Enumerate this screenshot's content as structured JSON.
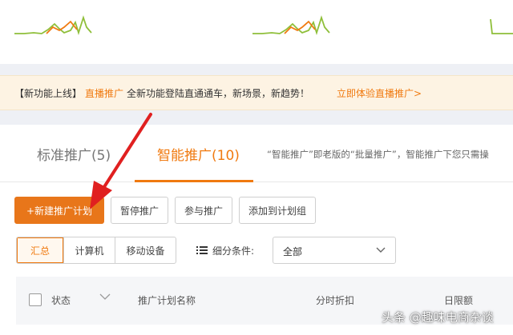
{
  "banner": {
    "tag": "【新功能上线】",
    "highlight": "直播推广",
    "text": "全新功能登陆直通通车，新场景，新趋势！",
    "link": "立即体验直播推广>"
  },
  "tabs": {
    "standard": "标准推广(5)",
    "smart": "智能推广(10)",
    "description": "“智能推广”即老版的“批量推广”，智能推广下您只需操"
  },
  "actions": {
    "new_plan": "+新建推广计划",
    "pause": "暂停推广",
    "join": "参与推广",
    "add_to_group": "添加到计划组"
  },
  "device_filter": {
    "options": [
      "汇总",
      "计算机",
      "移动设备"
    ],
    "active": "汇总"
  },
  "segment": {
    "label": "细分条件:",
    "selected": "全部"
  },
  "table": {
    "columns": {
      "status": "状态",
      "plan_name": "推广计划名称",
      "time_discount": "分时折扣",
      "daily_limit": "日限额"
    }
  },
  "watermark": "头条 @趣味电商杂谈",
  "colors": {
    "accent": "#f07a10",
    "primary_button": "#e8761a",
    "banner_bg": "#fdf3e3",
    "arrow": "#e02020"
  }
}
